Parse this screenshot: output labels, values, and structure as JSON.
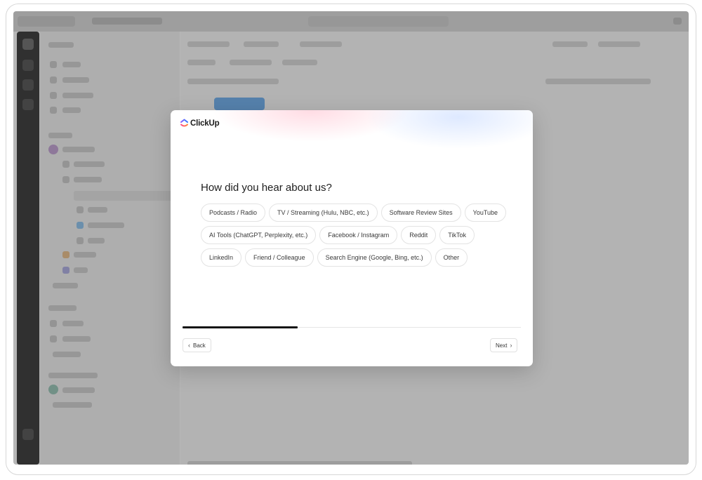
{
  "modal": {
    "brand": "ClickUp",
    "question": "How did you hear about us?",
    "options": [
      [
        "Podcasts / Radio",
        "TV / Streaming (Hulu, NBC, etc.)",
        "Software Review Sites",
        "YouTube"
      ],
      [
        "AI Tools (ChatGPT, Perplexity, etc.)",
        "Facebook / Instagram",
        "Reddit",
        "TikTok"
      ],
      [
        "LinkedIn",
        "Friend / Colleague",
        "Search Engine (Google, Bing, etc.)",
        "Other"
      ]
    ],
    "progress": 0.34,
    "back_label": "Back",
    "next_label": "Next",
    "back_icon": "chevron-left-icon",
    "next_icon": "chevron-right-icon"
  },
  "colors": {
    "overlay": "#505050",
    "progress": "#151515",
    "brand_pink": "#ff4d8d",
    "brand_blue": "#2f7bff"
  }
}
